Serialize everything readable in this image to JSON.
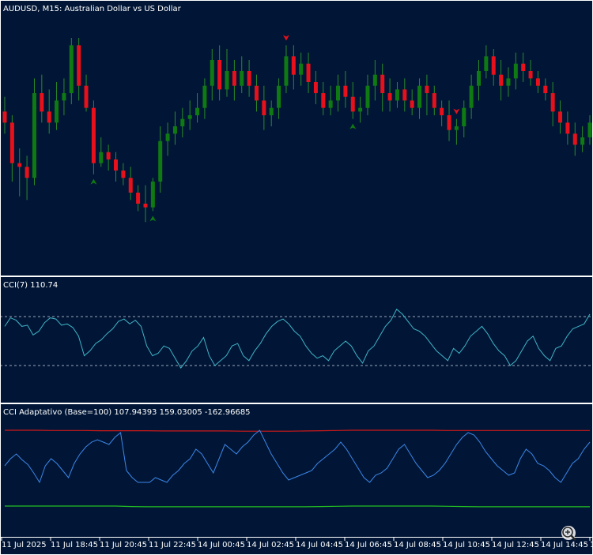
{
  "colors": {
    "background": "#011636",
    "frame": "#ffffff",
    "bull": "#0f7a12",
    "bear": "#e8101a",
    "wick": "#2a8a2a",
    "cci_line": "#3fb4c8",
    "cci_level": "#9aa6b8",
    "adaptive_line": "#3b86e8",
    "upper_band": "#d01818",
    "lower_band": "#22c022",
    "axis_text": "#ffffff"
  },
  "main_panel": {
    "title": "AUDUSD, M15:  Australian Dollar vs US Dollar",
    "buy_arrow_icon": "up-arrow-icon",
    "sell_arrow_icon": "down-arrow-icon"
  },
  "cci_panel": {
    "title": "CCI(7) 110.74"
  },
  "adaptive_panel": {
    "title": "CCI Adaptativo (Base=100) 107.94393 159.03005 -162.96685"
  },
  "time_axis": {
    "labels": [
      "11 Jul 2025",
      "11 Jul 18:45",
      "11 Jul 20:45",
      "11 Jul 22:45",
      "14 Jul 00:45",
      "14 Jul 02:45",
      "14 Jul 04:45",
      "14 Jul 06:45",
      "14 Jul 08:45",
      "14 Jul 10:45",
      "14 Jul 12:45",
      "14 Jul 14:45",
      "1"
    ]
  },
  "zoom_icon": "magnifier-plus-icon",
  "chart_data": [
    {
      "type": "candlestick",
      "series": [
        {
          "name": "AUDUSD, M15"
        }
      ],
      "values": [
        [
          98,
          92,
          106,
          86
        ],
        [
          92,
          70,
          96,
          60
        ],
        [
          70,
          68,
          78,
          52
        ],
        [
          68,
          62,
          74,
          50
        ],
        [
          62,
          108,
          116,
          58
        ],
        [
          108,
          98,
          118,
          92
        ],
        [
          98,
          92,
          110,
          86
        ],
        [
          92,
          104,
          114,
          88
        ],
        [
          104,
          108,
          116,
          96
        ],
        [
          108,
          134,
          138,
          102
        ],
        [
          134,
          112,
          138,
          104
        ],
        [
          112,
          100,
          118,
          98
        ],
        [
          100,
          70,
          104,
          64
        ],
        [
          70,
          76,
          84,
          68
        ],
        [
          76,
          72,
          80,
          66
        ],
        [
          72,
          66,
          76,
          60
        ],
        [
          66,
          62,
          70,
          58
        ],
        [
          62,
          54,
          68,
          50
        ],
        [
          54,
          48,
          58,
          44
        ],
        [
          48,
          46,
          58,
          38
        ],
        [
          46,
          60,
          62,
          44
        ],
        [
          60,
          82,
          90,
          54
        ],
        [
          82,
          86,
          92,
          74
        ],
        [
          86,
          90,
          98,
          80
        ],
        [
          90,
          94,
          100,
          84
        ],
        [
          94,
          96,
          104,
          88
        ],
        [
          96,
          100,
          108,
          92
        ],
        [
          100,
          112,
          116,
          94
        ],
        [
          112,
          126,
          132,
          104
        ],
        [
          126,
          110,
          134,
          104
        ],
        [
          110,
          120,
          132,
          106
        ],
        [
          120,
          112,
          126,
          104
        ],
        [
          112,
          120,
          128,
          108
        ],
        [
          120,
          112,
          126,
          106
        ],
        [
          112,
          104,
          118,
          98
        ],
        [
          104,
          96,
          112,
          88
        ],
        [
          96,
          100,
          104,
          90
        ],
        [
          100,
          112,
          116,
          94
        ],
        [
          112,
          128,
          134,
          108
        ],
        [
          128,
          118,
          134,
          110
        ],
        [
          118,
          124,
          130,
          112
        ],
        [
          124,
          114,
          130,
          108
        ],
        [
          114,
          108,
          120,
          102
        ],
        [
          108,
          100,
          114,
          96
        ],
        [
          100,
          104,
          112,
          96
        ],
        [
          104,
          112,
          118,
          98
        ],
        [
          112,
          106,
          120,
          100
        ],
        [
          106,
          98,
          114,
          94
        ],
        [
          98,
          100,
          106,
          92
        ],
        [
          100,
          112,
          118,
          96
        ],
        [
          112,
          118,
          126,
          104
        ],
        [
          118,
          108,
          124,
          98
        ],
        [
          108,
          104,
          116,
          98
        ],
        [
          104,
          110,
          114,
          100
        ],
        [
          110,
          104,
          116,
          98
        ],
        [
          104,
          100,
          110,
          96
        ],
        [
          100,
          112,
          116,
          94
        ],
        [
          112,
          108,
          118,
          96
        ],
        [
          108,
          100,
          112,
          96
        ],
        [
          100,
          96,
          104,
          90
        ],
        [
          96,
          88,
          104,
          82
        ],
        [
          88,
          90,
          94,
          80
        ],
        [
          90,
          100,
          104,
          84
        ],
        [
          100,
          112,
          118,
          94
        ],
        [
          112,
          120,
          126,
          104
        ],
        [
          120,
          128,
          134,
          116
        ],
        [
          128,
          118,
          132,
          112
        ],
        [
          118,
          112,
          126,
          104
        ],
        [
          112,
          116,
          122,
          106
        ],
        [
          116,
          124,
          130,
          110
        ],
        [
          124,
          120,
          130,
          114
        ],
        [
          120,
          116,
          126,
          112
        ],
        [
          116,
          112,
          120,
          108
        ],
        [
          112,
          108,
          116,
          104
        ],
        [
          108,
          98,
          114,
          90
        ],
        [
          98,
          92,
          104,
          86
        ],
        [
          92,
          86,
          98,
          80
        ],
        [
          86,
          80,
          92,
          74
        ],
        [
          80,
          84,
          90,
          76
        ],
        [
          84,
          92,
          96,
          80
        ]
      ]
    },
    {
      "type": "line",
      "series": [
        {
          "name": "CCI(7)",
          "values": [
            60,
            95,
            85,
            60,
            65,
            25,
            40,
            75,
            95,
            90,
            65,
            70,
            55,
            20,
            -60,
            -40,
            -10,
            5,
            30,
            50,
            80,
            90,
            70,
            85,
            60,
            -20,
            -60,
            -50,
            -20,
            -30,
            -70,
            -110,
            -80,
            -40,
            -20,
            15,
            -60,
            -100,
            -80,
            -60,
            -20,
            -10,
            -60,
            -80,
            -40,
            -10,
            30,
            60,
            80,
            90,
            70,
            40,
            20,
            -20,
            -50,
            -70,
            -60,
            -80,
            -40,
            -20,
            0,
            -20,
            -60,
            -90,
            -40,
            -20,
            20,
            60,
            85,
            130,
            110,
            80,
            50,
            40,
            20,
            -10,
            -40,
            -60,
            -80,
            -30,
            -50,
            -20,
            20,
            40,
            60,
            30,
            -10,
            -40,
            -60,
            -100,
            -80,
            -40,
            0,
            20,
            -30,
            -60,
            -80,
            -30,
            -20,
            20,
            50,
            60,
            70,
            110
          ]
        }
      ],
      "levels": [
        100,
        -100
      ],
      "current_value": 110.74
    },
    {
      "type": "line",
      "series": [
        {
          "name": "CCI Adaptativo",
          "values": [
            10,
            40,
            60,
            35,
            15,
            -20,
            -60,
            10,
            40,
            20,
            -10,
            -40,
            20,
            60,
            90,
            110,
            120,
            110,
            100,
            130,
            150,
            -10,
            -40,
            -60,
            -60,
            -60,
            -40,
            -50,
            -60,
            -30,
            -10,
            20,
            40,
            80,
            60,
            20,
            -20,
            40,
            100,
            80,
            60,
            90,
            110,
            140,
            160,
            110,
            60,
            20,
            -20,
            -50,
            -40,
            -30,
            -20,
            -10,
            20,
            40,
            60,
            80,
            110,
            80,
            40,
            0,
            -40,
            -60,
            -30,
            -20,
            0,
            40,
            80,
            100,
            60,
            20,
            -10,
            -40,
            -30,
            -10,
            20,
            60,
            100,
            130,
            150,
            140,
            110,
            70,
            40,
            10,
            -10,
            -30,
            -20,
            40,
            80,
            60,
            20,
            10,
            -10,
            -40,
            -60,
            -20,
            20,
            40,
            80,
            110
          ]
        },
        {
          "name": "Upper band",
          "values": [
            160,
            160,
            160,
            159,
            159,
            159,
            158,
            158,
            158,
            158,
            157,
            157,
            157,
            157,
            157,
            156,
            156,
            156,
            156,
            157,
            158,
            159,
            160,
            160,
            160,
            160,
            160,
            160,
            159,
            159,
            159,
            159,
            159,
            159,
            159,
            159,
            159,
            159
          ]
        },
        {
          "name": "Lower band",
          "values": [
            -160,
            -160,
            -160,
            -160,
            -160,
            -160,
            -160,
            -160,
            -162,
            -163,
            -163,
            -163,
            -163,
            -163,
            -163,
            -163,
            -163,
            -163,
            -163,
            -163,
            -162,
            -161,
            -160,
            -160,
            -160,
            -160,
            -160,
            -160,
            -161,
            -162,
            -163,
            -163,
            -163,
            -163,
            -163,
            -163,
            -163,
            -163
          ]
        }
      ],
      "current_values": [
        107.94393,
        159.03005,
        -162.96685
      ]
    }
  ]
}
